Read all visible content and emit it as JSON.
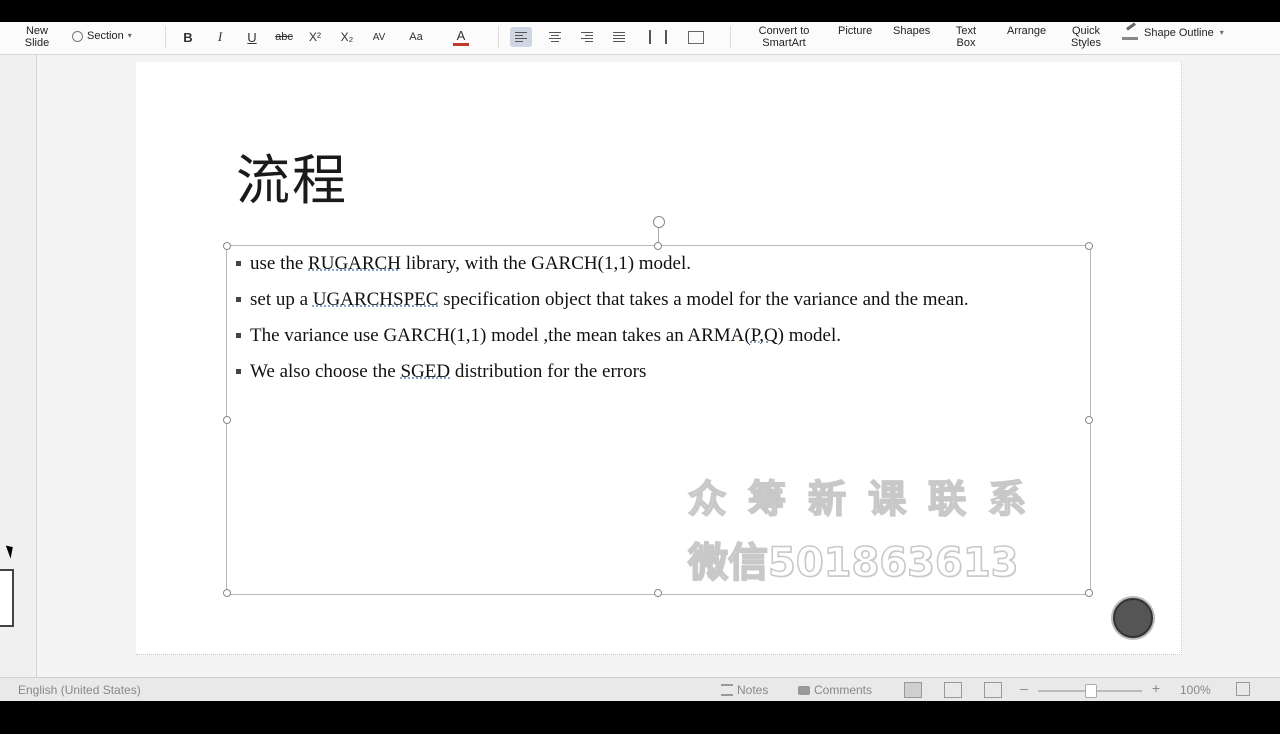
{
  "ribbon": {
    "new_slide": [
      "New",
      "Slide"
    ],
    "section": "Section",
    "bold": "B",
    "italic": "I",
    "underline": "U",
    "strike": "abc",
    "superscript": "X²",
    "subscript": "X₂",
    "spacing": "AV",
    "change_case": "Aa",
    "font_color": "A",
    "convert_smartart": [
      "Convert to",
      "SmartArt"
    ],
    "picture": "Picture",
    "shapes": "Shapes",
    "text_box": [
      "Text",
      "Box"
    ],
    "arrange": "Arrange",
    "quick_styles": [
      "Quick",
      "Styles"
    ],
    "shape_outline": "Shape Outline"
  },
  "slide": {
    "title": "流程",
    "bullets": [
      {
        "parts": [
          "use the ",
          "RUGARCH",
          "  library, with the GARCH(1,1) model."
        ]
      },
      {
        "parts": [
          "set up a ",
          "UGARCHSPEC",
          "  specification object that takes a model for the variance and the mean."
        ]
      },
      {
        "parts": [
          "The variance use GARCH(1,1) model ,the mean takes an ARMA(",
          "P,Q",
          ") model."
        ]
      },
      {
        "parts": [
          "We also choose the ",
          "SGED",
          "  distribution for the errors"
        ]
      }
    ],
    "watermark_line1": "众筹新课联系",
    "watermark_line2": "微信501863613"
  },
  "status": {
    "language": "English (United States)",
    "notes": "Notes",
    "comments": "Comments",
    "zoom": "100%"
  }
}
